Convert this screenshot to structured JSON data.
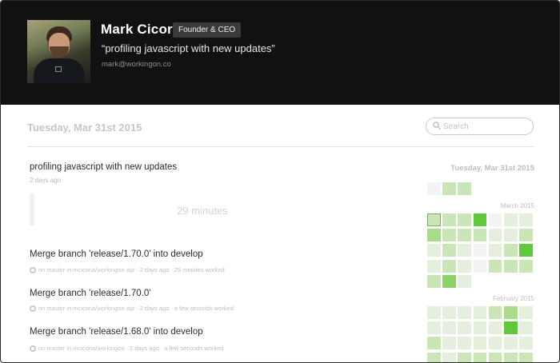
{
  "profile": {
    "name": "Mark Cicoria",
    "role": "Founder & CEO",
    "status": "“profiling javascript with new updates”",
    "email": "mark@workingon.co"
  },
  "page": {
    "date_title": "Tuesday, Mar 31st 2015"
  },
  "search": {
    "placeholder": "Search"
  },
  "feed": {
    "current": {
      "title": "profiling javascript with new updates",
      "time": "2 days ago",
      "duration": "29 minutes"
    },
    "commits": [
      {
        "title": "Merge branch 'release/1.70.0' into develop",
        "branch_repo": "on master in mcicoria/workingon-api",
        "time": "2 days ago",
        "worked": "29 minutes worked"
      },
      {
        "title": "Merge branch 'release/1.70.0'",
        "branch_repo": "on master in mcicoria/workingon-api",
        "time": "2 days ago",
        "worked": "a few seconds worked"
      },
      {
        "title": "Merge branch 'release/1.68.0' into develop",
        "branch_repo": "on master in mcicoria/workingon",
        "time": "2 days ago",
        "worked": "a few seconds worked"
      }
    ]
  },
  "sidebar": {
    "date": "Tuesday, Mar 31st 2015",
    "day_row": [
      0,
      2,
      2
    ],
    "months": [
      {
        "label": "March 2015",
        "rows": [
          [
            2,
            2,
            2,
            5,
            0,
            1,
            1
          ],
          [
            3,
            2,
            2,
            2,
            1,
            1,
            2
          ],
          [
            1,
            2,
            1,
            0,
            1,
            2,
            5
          ],
          [
            1,
            2,
            1,
            0,
            2,
            2,
            2
          ],
          [
            2,
            4,
            1
          ]
        ],
        "selected": [
          0,
          0
        ]
      },
      {
        "label": "February 2015",
        "rows": [
          [
            1,
            1,
            1,
            1,
            2,
            3,
            1
          ],
          [
            1,
            1,
            1,
            1,
            1,
            5,
            1
          ],
          [
            2,
            1,
            1,
            1,
            1,
            1,
            1
          ],
          [
            2,
            1,
            2,
            2,
            2,
            2,
            2
          ]
        ]
      }
    ]
  }
}
